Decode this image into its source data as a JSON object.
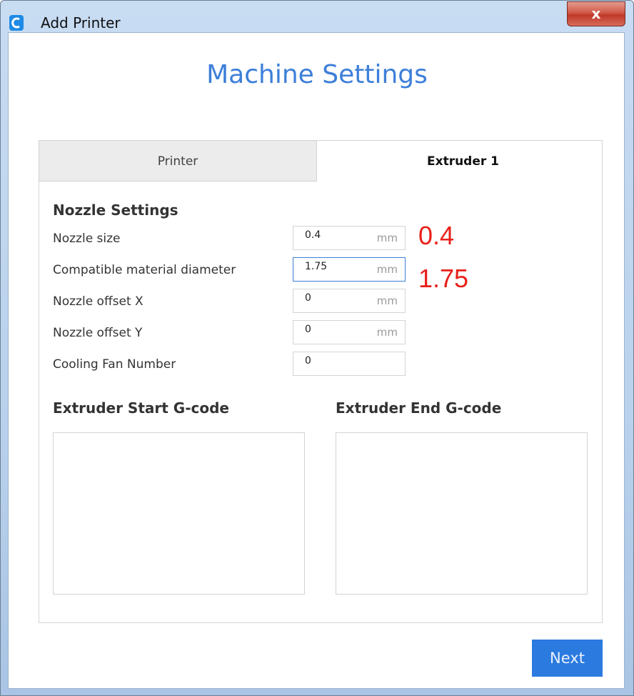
{
  "window": {
    "title": "Add Printer",
    "close_glyph": "x",
    "app_icon": "cura-logo-icon"
  },
  "page": {
    "title": "Machine Settings"
  },
  "tabs": [
    {
      "label": "Printer",
      "active": false
    },
    {
      "label": "Extruder 1",
      "active": true
    }
  ],
  "nozzle_settings": {
    "heading": "Nozzle Settings",
    "rows": [
      {
        "label": "Nozzle size",
        "value": "0.4",
        "unit": "mm"
      },
      {
        "label": "Compatible material diameter",
        "value": "1.75",
        "unit": "mm"
      },
      {
        "label": "Nozzle offset X",
        "value": "0",
        "unit": "mm"
      },
      {
        "label": "Nozzle offset Y",
        "value": "0",
        "unit": "mm"
      },
      {
        "label": "Cooling Fan Number",
        "value": "0",
        "unit": ""
      }
    ]
  },
  "annotations": {
    "nozzle_size": "0.4",
    "material_diameter": "1.75",
    "color": "#e8201a"
  },
  "gcode": {
    "start_heading": "Extruder Start G-code",
    "end_heading": "Extruder End G-code",
    "start_value": "",
    "end_value": ""
  },
  "footer": {
    "next_label": "Next"
  },
  "colors": {
    "accent": "#3d7fd9",
    "button": "#2b7ae0"
  }
}
